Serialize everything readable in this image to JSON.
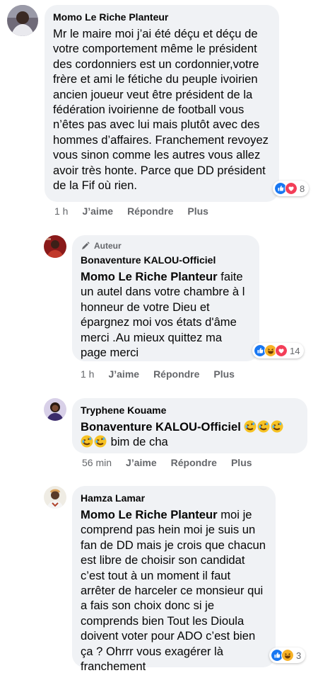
{
  "comments": [
    {
      "author": "Momo Le Riche Planteur",
      "text": "Mr le maire moi j’ai été déçu et déçu de votre comportement même le président des cordonniers est un cordonnier,votre frère et ami le fétiche du peuple ivoirien ancien joueur veut être président de la fédération ivoirienne de football vous n’êtes pas avec lui mais plutôt avec des hommes d’affaires. Franchement revoyez vous sinon comme les autres vous allez avoir très honte. Parce que DD président de la Fif où rien.",
      "time": "1 h",
      "like": "J’aime",
      "reply": "Répondre",
      "more": "Plus",
      "reaction_count": "8",
      "reactions": [
        "like-icon",
        "love-icon"
      ]
    },
    {
      "badge": "Auteur",
      "author": "Bonaventure KALOU-Officiel",
      "mention": "Momo Le Riche Planteur",
      "text": " faite un autel dans votre chambre à l honneur de votre Dieu et épargnez moi vos états d'âme merci .Au mieux quittez ma page merci",
      "time": "1 h",
      "like": "J’aime",
      "reply": "Répondre",
      "more": "Plus",
      "reaction_count": "14",
      "reactions": [
        "like-icon",
        "haha-icon",
        "love-icon"
      ]
    },
    {
      "author": "Tryphene Kouame",
      "mention": "Bonaventure KALOU-Officiel",
      "text": " bim de cha",
      "time": "56 min",
      "like": "J’aime",
      "reply": "Répondre",
      "more": "Plus"
    },
    {
      "author": "Hamza Lamar",
      "mention": "Momo Le Riche Planteur",
      "text": " moi je comprend pas hein moi je suis un fan de DD mais je crois que chacun est libre de choisir son candidat c’est tout à un moment il faut arrêter de harceler ce monsieur qui a fais son choix donc si je comprends bien Tout les Dioula doivent voter pour ADO c’est bien ça ? Ohrrr vous exagérer là franchement",
      "reaction_count": "3",
      "reactions": [
        "like-icon",
        "haha-icon"
      ]
    }
  ],
  "colors": {
    "bubble": "#f0f2f5",
    "secondary_text": "#65676b",
    "like_blue": "#1877f2",
    "love_red": "#f33e58",
    "haha_yellow": "#f7b125"
  }
}
